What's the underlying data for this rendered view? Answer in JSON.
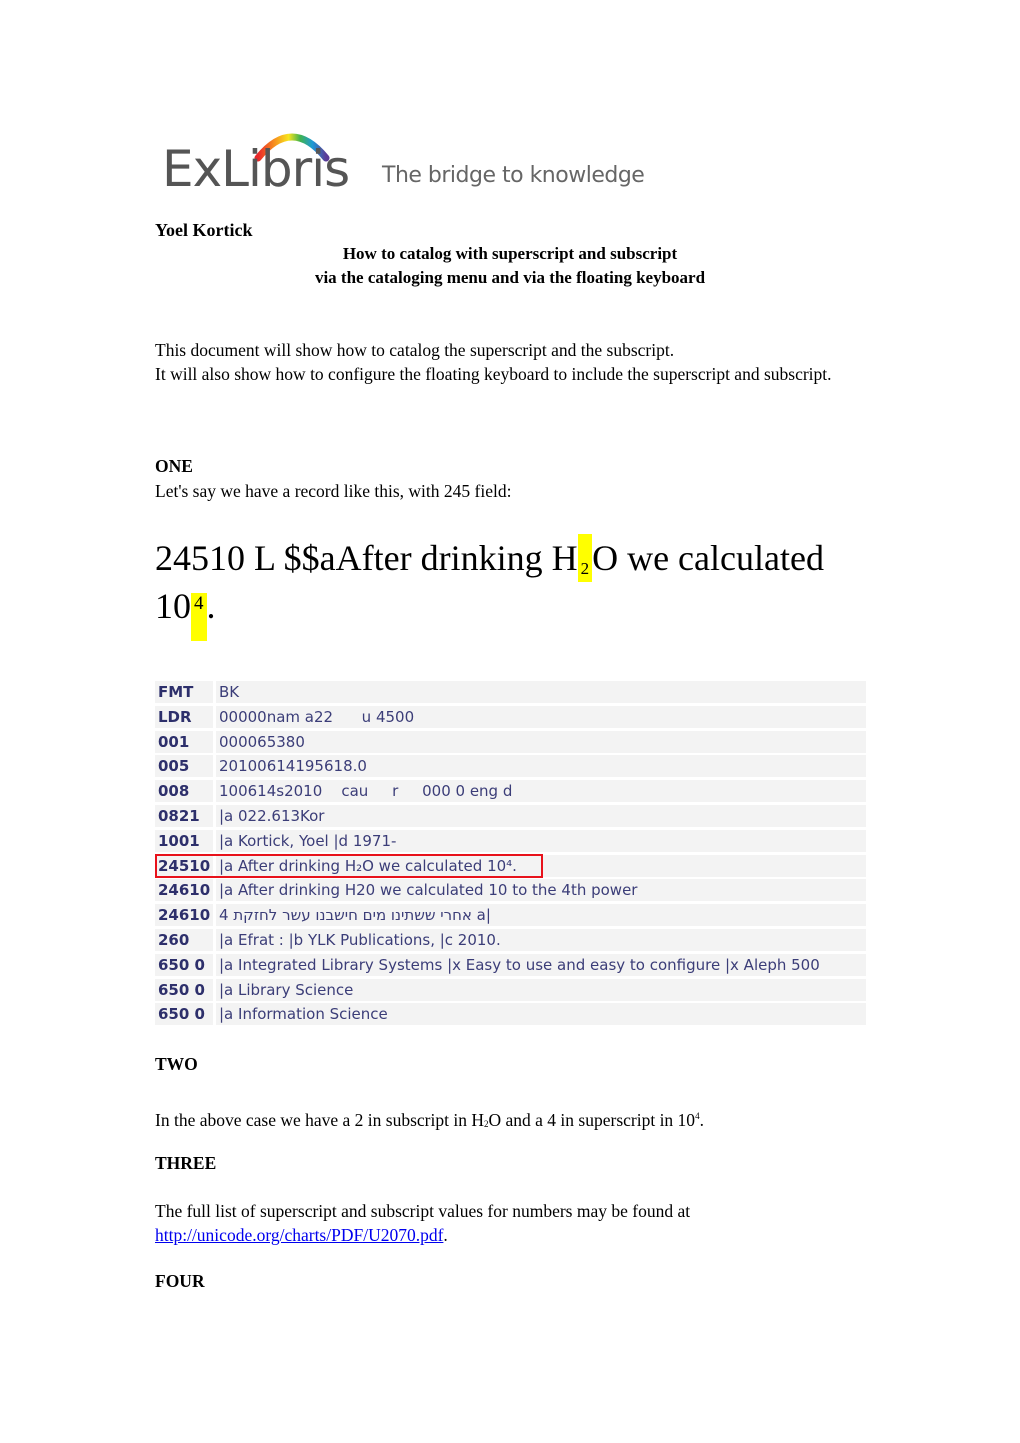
{
  "logo": {
    "brand": "ExLibris",
    "tagline": "The bridge to knowledge",
    "arc_colors": [
      "#e8272a",
      "#f7931e",
      "#f7e51e",
      "#3fb34f",
      "#1e9ad6",
      "#5b3a97"
    ]
  },
  "header": {
    "author": "Yoel Kortick",
    "title_line1": "How to catalog with superscript and subscript",
    "title_line2": "via the cataloging menu and via the floating keyboard"
  },
  "intro": {
    "line1": "This document will show how to catalog the superscript and the subscript.",
    "line2": "It will also show how to configure the floating keyboard to include the superscript and subscript."
  },
  "section_one": {
    "heading": "ONE",
    "text": "Let's say we have a record like this, with 245 field:",
    "example": {
      "before_sub": "24510 L $$aAfter drinking H",
      "subscript": "2",
      "between": "O we calculated",
      "line2_before_sup": "10",
      "superscript": "4",
      "after_sup": "."
    },
    "highlight_color": "#ffff00"
  },
  "marc_record": {
    "tag_color": "#2d2f6b",
    "value_color": "#3b3d78",
    "row_bg": "#f3f3f3",
    "highlight_border": "#e8121b",
    "rows": [
      {
        "tag": "FMT",
        "value": "BK"
      },
      {
        "tag": "LDR",
        "value": "00000nam a22      u 4500"
      },
      {
        "tag": "001",
        "value": "000065380"
      },
      {
        "tag": "005",
        "value": "20100614195618.0"
      },
      {
        "tag": "008",
        "value": "100614s2010    cau     r     000 0 eng d"
      },
      {
        "tag": "0821",
        "value": "|a 022.613Kor"
      },
      {
        "tag": "1001",
        "value": "|a Kortick, Yoel |d 1971-"
      },
      {
        "tag": "24510",
        "value": "|a After drinking H₂O we calculated 10⁴."
      },
      {
        "tag": "24610",
        "value": "|a After drinking H20 we calculated 10 to the 4th power"
      },
      {
        "tag": "24610",
        "value": "4 אחרי ששתינו מים חישבנו עשר לחזקת a|"
      },
      {
        "tag": "260",
        "value": "|a Efrat : |b YLK Publications, |c 2010."
      },
      {
        "tag": "650 0",
        "value": "|a Integrated Library Systems |x Easy to use and easy to configure |x Aleph 500"
      },
      {
        "tag": "650 0",
        "value": "|a Library Science"
      },
      {
        "tag": "650 0",
        "value": "|a Information Science"
      }
    ]
  },
  "section_two": {
    "heading": "TWO",
    "text_part1": "In the above case we have a 2 in subscript in H",
    "sub": "2",
    "text_part2": "O and a 4 in superscript in 10",
    "sup": "4",
    "text_part3": "."
  },
  "section_three": {
    "heading": "THREE",
    "text": "The full list of superscript and subscript values for numbers may be found at",
    "link": "http://unicode.org/charts/PDF/U2070.pdf",
    "after_link": "."
  },
  "section_four": {
    "heading": "FOUR"
  }
}
